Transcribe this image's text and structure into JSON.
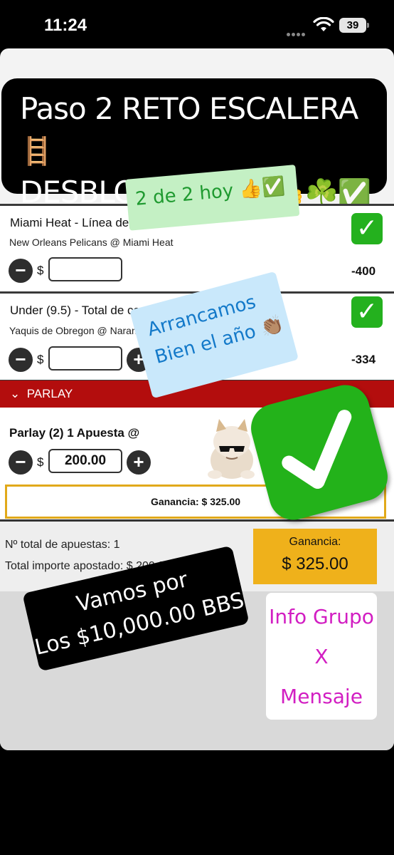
{
  "status_bar": {
    "time": "11:24",
    "battery": "39"
  },
  "headline": {
    "line1": "Paso 2 RETO ESCALERA",
    "line1_emoji": "🪜",
    "line2": "DESBLOQUEADO",
    "line2_emoji": "👍☘️✅"
  },
  "bets": [
    {
      "title": "Miami Heat - Línea de Dinero",
      "match": "New Orleans Pelicans @ Miami Heat",
      "odds": "-400",
      "currency": "$",
      "amount": ""
    },
    {
      "title": "Under (9.5) - Total de carreras (Incluye Prórroga)",
      "match": "Yaquis de Obregon @ Naranjeros de Hermosillo",
      "odds": "-334",
      "currency": "$",
      "amount": ""
    }
  ],
  "parlay": {
    "header": "PARLAY",
    "chevron": "⌄",
    "title": "Parlay (2)   1 Apuesta @",
    "currency": "$",
    "amount": "200.00",
    "gain_text": "Ganancia: $ 325.00"
  },
  "summary": {
    "total_bets": "Nº total de apuestas: 1",
    "total_staked": "Total importe apostado: $ 200.00",
    "gain_label": "Ganancia:",
    "gain_value": "$ 325.00"
  },
  "stickers": {
    "hoy": "2 de 2 hoy",
    "hoy_emoji": "👍✅",
    "arrancamos_1": "Arrancamos",
    "arrancamos_2": "Bien el año",
    "arrancamos_emoji": "👏🏽",
    "vamos_1": "Vamos por",
    "vamos_2": "Los $10,000.00 BBS",
    "info_1": "Info Grupo",
    "info_2": "X",
    "info_3": "Mensaje"
  },
  "icons": {
    "check": "check-icon",
    "minus": "minus-icon",
    "plus": "plus-icon",
    "wifi": "wifi-icon",
    "battery": "battery-icon"
  },
  "colors": {
    "brand_red": "#b30d0d",
    "check_green": "#24b11e",
    "gain_gold": "#efb11b"
  }
}
